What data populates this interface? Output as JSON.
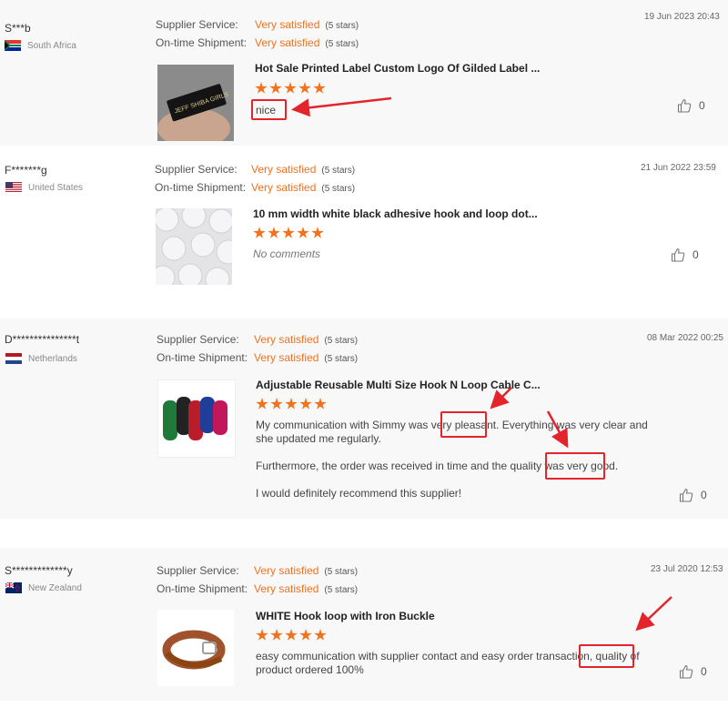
{
  "labels": {
    "supplier_service": "Supplier Service:",
    "ontime_shipment": "On-time Shipment:"
  },
  "reviews": [
    {
      "name": "S***b",
      "country": "South Africa",
      "supplier_value": "Very satisfied",
      "supplier_stars": "(5 stars)",
      "shipment_value": "Very satisfied",
      "shipment_stars": "(5 stars)",
      "date": "19 Jun 2023 20:43",
      "product_title": "Hot Sale Printed Label Custom Logo Of Gilded Label ...",
      "product_image_text": "JEFF SHIBA GIRLS",
      "rating": 5,
      "comment": "nice",
      "likes": "0"
    },
    {
      "name": "F*******g",
      "country": "United States",
      "supplier_value": "Very satisfied",
      "supplier_stars": "(5 stars)",
      "shipment_value": "Very satisfied",
      "shipment_stars": "(5 stars)",
      "date": "21 Jun 2022 23:59",
      "product_title": "10 mm width white black adhesive hook and loop dot...",
      "rating": 5,
      "comment": "No comments",
      "likes": "0"
    },
    {
      "name": "D***************t",
      "country": "Netherlands",
      "supplier_value": "Very satisfied",
      "supplier_stars": "(5 stars)",
      "shipment_value": "Very satisfied",
      "shipment_stars": "(5 stars)",
      "date": "08 Mar 2022 00:25",
      "product_title": "Adjustable Reusable Multi Size Hook N Loop Cable C...",
      "rating": 5,
      "comment_line1": "My communication with Simmy was very pleasant. Everything was very clear and",
      "comment_line2": "she updated me regularly.",
      "comment_line3": "Furthermore, the order was received in time and the quality was very good.",
      "comment_line4": "I would definitely recommend this supplier!",
      "likes": "0"
    },
    {
      "name": "S*************y",
      "country": "New Zealand",
      "supplier_value": "Very satisfied",
      "supplier_stars": "(5 stars)",
      "shipment_value": "Very satisfied",
      "shipment_stars": "(5 stars)",
      "date": "23 Jul 2020 12:53",
      "product_title": "WHITE Hook loop with Iron Buckle",
      "rating": 5,
      "comment_line1": "easy communication with supplier contact and easy order transaction, quality of",
      "comment_line2": "product ordered 100%",
      "likes": "0"
    }
  ],
  "colors": {
    "accent": "#f2711c",
    "highlight": "#e3242b"
  },
  "icons": {
    "like": "thumbs-up-icon",
    "arrow": "red-arrow-annotation"
  }
}
